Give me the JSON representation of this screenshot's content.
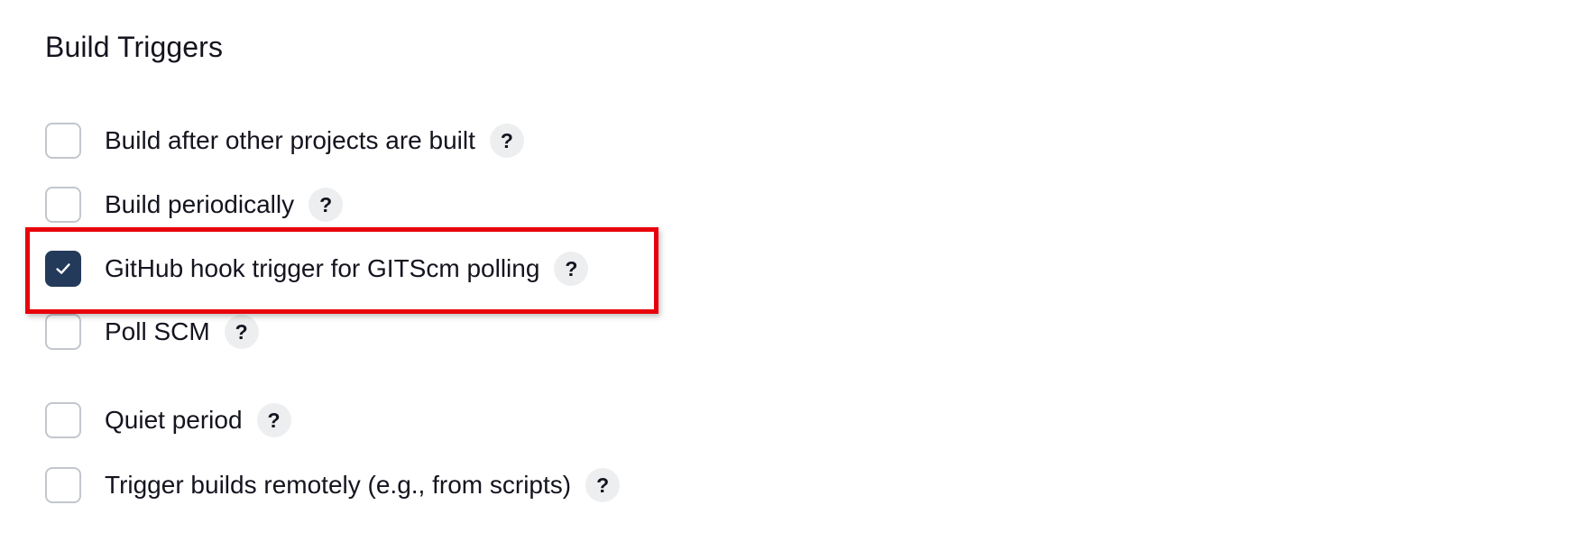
{
  "section": {
    "title": "Build Triggers"
  },
  "triggers": [
    {
      "label": "Build after other projects are built",
      "checked": false,
      "help": "?"
    },
    {
      "label": "Build periodically",
      "checked": false,
      "help": "?"
    },
    {
      "label": "GitHub hook trigger for GITScm polling",
      "checked": true,
      "help": "?"
    },
    {
      "label": "Poll SCM",
      "checked": false,
      "help": "?"
    },
    {
      "label": "Quiet period",
      "checked": false,
      "help": "?"
    },
    {
      "label": "Trigger builds remotely (e.g., from scripts)",
      "checked": false,
      "help": "?"
    }
  ],
  "colors": {
    "checked_fill": "#243a5a",
    "unchecked_border": "#c3c7cd",
    "highlight_border": "#e8000b",
    "help_bg": "#eceef0"
  }
}
